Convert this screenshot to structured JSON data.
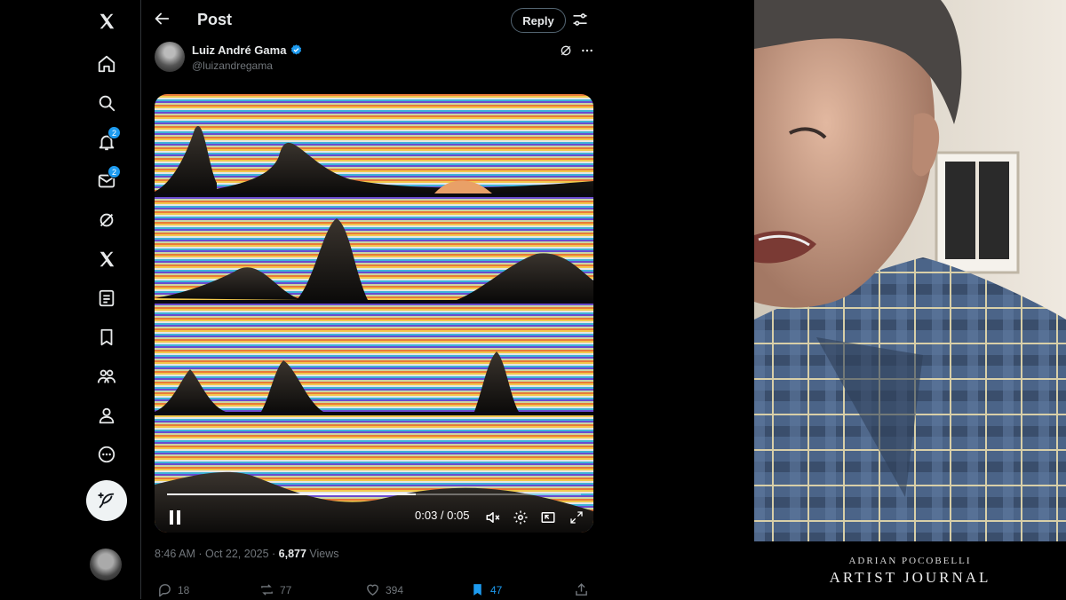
{
  "sidebar": {
    "items": [
      {
        "icon": "x-logo-icon"
      },
      {
        "icon": "home-icon"
      },
      {
        "icon": "search-icon"
      },
      {
        "icon": "bell-icon",
        "badge": "2"
      },
      {
        "icon": "mail-icon",
        "badge": "2"
      },
      {
        "icon": "grok-icon"
      },
      {
        "icon": "x-premium-icon"
      },
      {
        "icon": "lists-icon"
      },
      {
        "icon": "bookmark-icon"
      },
      {
        "icon": "communities-icon"
      },
      {
        "icon": "profile-icon"
      },
      {
        "icon": "more-icon"
      }
    ],
    "compose_icon": "feather-plus-icon"
  },
  "header": {
    "title": "Post",
    "reply_label": "Reply"
  },
  "post": {
    "author_name": "Luiz André Gama",
    "verified": true,
    "handle": "@luizandregama",
    "video": {
      "current_time": "0:03",
      "duration": "0:05",
      "time_label": "0:03 / 0:05",
      "progress": 0.6
    },
    "time": "8:46 AM · Oct 22, 2025 · ",
    "views_count": "6,877",
    "views_label": " Views",
    "stats": {
      "replies": "18",
      "reposts": "77",
      "likes": "394",
      "bookmarks": "47"
    }
  },
  "overlay": {
    "name": "ADRIAN POCOBELLI",
    "title": "ARTIST JOURNAL"
  },
  "colors": {
    "accent": "#1d9bf0",
    "background": "#000000",
    "text": "#e7e9ea",
    "muted": "#71767b"
  }
}
